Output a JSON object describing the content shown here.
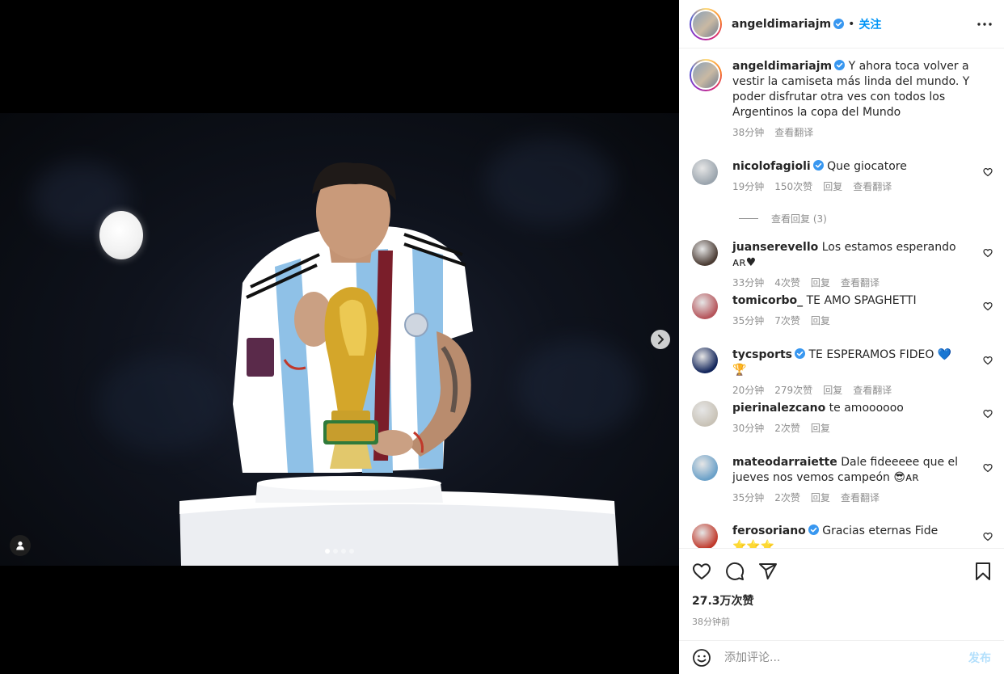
{
  "post": {
    "author": "angeldimariajm",
    "follow_label": "关注",
    "separator": "•",
    "caption_text": "Y ahora toca volver a vestir la camiseta más linda del mundo. Y poder disfrutar otra ves con todos los Argentinos la copa del Mundo",
    "caption_time": "38分钟",
    "caption_translate": "查看翻译",
    "likes": "27.3万次赞",
    "posted_ago": "38分钟前"
  },
  "media": {
    "carousel_count": 4,
    "carousel_active_index": 0,
    "next_icon": "chevron-right-icon",
    "tag_icon": "user-tag-icon"
  },
  "comments": [
    {
      "user": "nicolofagioli",
      "verified": true,
      "text": "Que giocatore",
      "time": "19分钟",
      "likes": "150次赞",
      "reply": "回复",
      "translate": "查看翻译",
      "avatar_color": "#9aa4ad"
    },
    {
      "user": "juanserevello",
      "verified": false,
      "text": "Los estamos esperando ᴀʀ♥",
      "time": "33分钟",
      "likes": "4次赞",
      "reply": "回复",
      "translate": "查看翻译",
      "avatar_color": "#4a3b33"
    },
    {
      "user": "tomicorbo_",
      "verified": false,
      "text": "TE AMO SPAGHETTI",
      "time": "35分钟",
      "likes": "7次赞",
      "reply": "回复",
      "translate": "",
      "avatar_color": "#b5545a"
    },
    {
      "user": "tycsports",
      "verified": true,
      "text": "TE ESPERAMOS FIDEO 💙🏆",
      "time": "20分钟",
      "likes": "279次赞",
      "reply": "回复",
      "translate": "查看翻译",
      "avatar_color": "#11245a"
    },
    {
      "user": "pierinalezcano",
      "verified": false,
      "text": "te amoooooo",
      "time": "30分钟",
      "likes": "2次赞",
      "reply": "回复",
      "translate": "",
      "avatar_color": "#c8c2b6"
    },
    {
      "user": "mateodarraiette",
      "verified": false,
      "text": "Dale fideeeee que el jueves nos vemos campeón 😎ᴀʀ",
      "time": "35分钟",
      "likes": "2次赞",
      "reply": "回复",
      "translate": "查看翻译",
      "avatar_color": "#6aa0c8"
    },
    {
      "user": "ferosoriano",
      "verified": true,
      "text": "Gracias eternas Fide ⭐⭐⭐",
      "time": "",
      "likes": "",
      "reply": "",
      "translate": "",
      "avatar_color": "#c0392b"
    }
  ],
  "view_replies": "查看回复 (3)",
  "add_comment": {
    "placeholder": "添加评论...",
    "post_label": "发布"
  },
  "colors": {
    "accent": "#0095f6",
    "verified": "#3897f0",
    "muted": "#8e8e8e",
    "post_disabled": "#b2dffc"
  }
}
